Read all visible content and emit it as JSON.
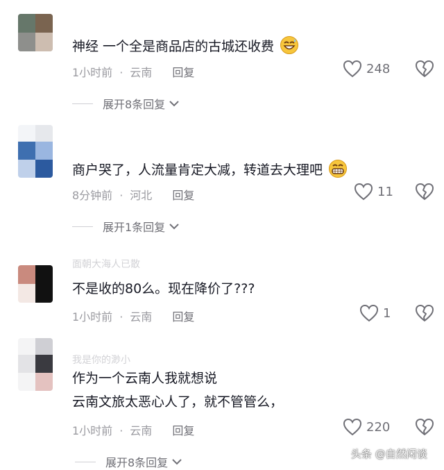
{
  "comments": [
    {
      "lines": [
        "神经  一个全是商品店的古城还收费"
      ],
      "name_faded": "",
      "time": "1小时前",
      "location": "云南",
      "reply_label": "回复",
      "likes": "248",
      "expand_label": "展开8条回复",
      "emoji": "grinning-sweat-emoji",
      "avatar_colors": [
        "#5a6b5e",
        "#7a6a58",
        "#8c8d8a",
        "#c9b9aa"
      ]
    },
    {
      "lines": [
        "商户哭了，人流量肯定大减，转道去大理吧"
      ],
      "name_faded": "",
      "time": "8分钟前",
      "location": "河北",
      "reply_label": "回复",
      "likes": "11",
      "expand_label": "展开1条回复",
      "emoji": "grinning-teeth-emoji",
      "avatar_colors": [
        "#e8eef6",
        "#d9e4f2",
        "#3c6fb2",
        "#8fb0dd",
        "#2e5ca0"
      ]
    },
    {
      "lines": [
        "不是收的80么。现在降价了???"
      ],
      "name_faded": "面朝大海人已散",
      "time": "1小时前",
      "location": "云南",
      "reply_label": "回复",
      "likes": "1",
      "expand_label": "",
      "emoji": "",
      "avatar_colors": [
        "#c98a7e",
        "#111111",
        "#f2e6e2",
        "#111111"
      ]
    },
    {
      "lines": [
        "作为一个云南人我就想说",
        "云南文旅太恶心人了，就不管管么，"
      ],
      "name_faded": "我是你的渺小",
      "time": "1小时前",
      "location": "云南",
      "reply_label": "回复",
      "likes": "220",
      "expand_label": "展开8条回复",
      "emoji": "",
      "avatar_colors": [
        "#d6d6da",
        "#3a3a40",
        "#eeeeef",
        "#c9a7a4"
      ]
    }
  ],
  "watermark": "头条 @自然闲谈"
}
